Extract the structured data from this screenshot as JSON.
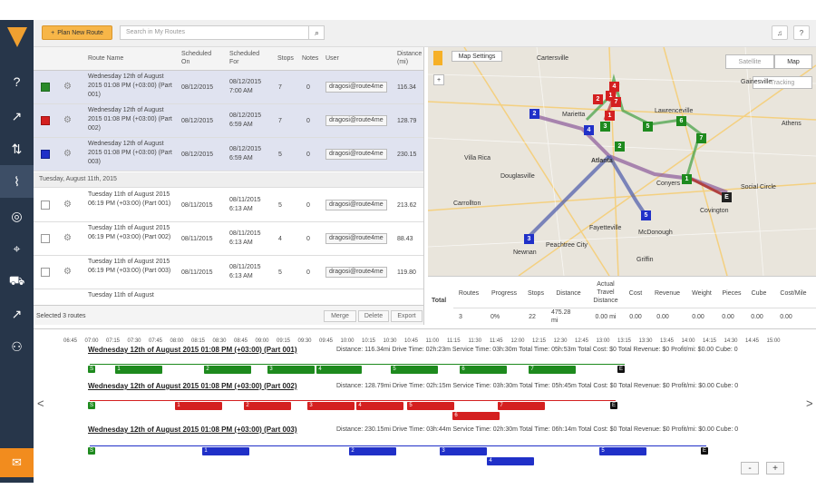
{
  "topbar": {
    "plan_button": "Plan New Route",
    "search_placeholder": "Search in My Routes"
  },
  "grid": {
    "headers": {
      "name": "Route Name",
      "scheduled_on": "Scheduled On",
      "scheduled_for": "Scheduled For",
      "stops": "Stops",
      "notes": "Notes",
      "user": "User",
      "distance": "Distance (mi)"
    },
    "rows": [
      {
        "name": "Wednesday 12th of August 2015 01:08 PM (+03:00) (Part 001)",
        "on": "08/12/2015",
        "for": "08/12/2015 7:00 AM",
        "stops": "7",
        "notes": "0",
        "user": "dragosi@route4me",
        "dist": "116.34"
      },
      {
        "name": "Wednesday 12th of August 2015 01:08 PM (+03:00) (Part 002)",
        "on": "08/12/2015",
        "for": "08/12/2015 6:59 AM",
        "stops": "7",
        "notes": "0",
        "user": "dragosi@route4me",
        "dist": "128.79"
      },
      {
        "name": "Wednesday 12th of August 2015 01:08 PM (+03:00) (Part 003)",
        "on": "08/12/2015",
        "for": "08/12/2015 6:59 AM",
        "stops": "5",
        "notes": "0",
        "user": "dragosi@route4me",
        "dist": "230.15"
      },
      {
        "name": "Tuesday 11th of August 2015 06:19 PM (+03:00) (Part 001)",
        "on": "08/11/2015",
        "for": "08/11/2015 6:13 AM",
        "stops": "5",
        "notes": "0",
        "user": "dragosi@route4me",
        "dist": "213.62"
      },
      {
        "name": "Tuesday 11th of August 2015 06:19 PM (+03:00) (Part 002)",
        "on": "08/11/2015",
        "for": "08/11/2015 6:13 AM",
        "stops": "4",
        "notes": "0",
        "user": "dragosi@route4me",
        "dist": "88.43"
      },
      {
        "name": "Tuesday 11th of August 2015 06:19 PM (+03:00) (Part 003)",
        "on": "08/11/2015",
        "for": "08/11/2015 6:13 AM",
        "stops": "5",
        "notes": "0",
        "user": "dragosi@route4me",
        "dist": "119.80"
      },
      {
        "name": "Tuesday 11th of August",
        "on": "",
        "for": "",
        "stops": "",
        "notes": "",
        "user": "",
        "dist": ""
      }
    ],
    "group_label": "Tuesday, August 11th, 2015",
    "footer": {
      "selected": "Selected 3 routes",
      "merge": "Merge",
      "delete": "Delete",
      "export": "Export"
    }
  },
  "map": {
    "settings": "Map Settings",
    "satellite": "Satellite",
    "map": "Map",
    "tracking": "Tracking",
    "city_labels": [
      "Marietta",
      "Atlanta",
      "Carrollton",
      "Newnan",
      "Peachtree City",
      "Fayetteville",
      "McDonough",
      "Social Circle",
      "Covington",
      "Lawrenceville",
      "Cartersville",
      "Gainesville",
      "Conyers",
      "Griffin",
      "Villa Rica",
      "Douglasville",
      "Athens"
    ]
  },
  "stats": {
    "headers": [
      "Routes",
      "Progress",
      "Stops",
      "Distance",
      "Actual Travel Distance",
      "Cost",
      "Revenue",
      "Weight",
      "Pieces",
      "Cube",
      "Cost/Mile"
    ],
    "total_label": "Total",
    "values": [
      "3",
      "0%",
      "22",
      "475.28 mi",
      "0.00 mi",
      "0.00",
      "0.00",
      "0.00",
      "0.00",
      "0.00",
      "0.00"
    ]
  },
  "timeline": {
    "ticks": [
      "06:45",
      "07:00",
      "07:15",
      "07:30",
      "07:45",
      "08:00",
      "08:15",
      "08:30",
      "08:45",
      "09:00",
      "09:15",
      "09:30",
      "09:45",
      "10:00",
      "10:15",
      "10:30",
      "10:45",
      "11:00",
      "11:15",
      "11:30",
      "11:45",
      "12:00",
      "12:15",
      "12:30",
      "12:45",
      "13:00",
      "13:15",
      "13:30",
      "13:45",
      "14:00",
      "14:15",
      "14:30",
      "14:45",
      "15:00"
    ],
    "routes": [
      {
        "title": "Wednesday 12th of August 2015 01:08 PM (+03:00) (Part 001)",
        "info": "Distance: 116.34mi    Drive Time: 02h:23m    Service Time: 03h:30m    Total Time: 05h:53m    Total Cost: $0    Total Revenue: $0    Profit/mi: $0.00    Cube: 0",
        "color": "#1e8a1e"
      },
      {
        "title": "Wednesday 12th of August 2015 01:08 PM (+03:00) (Part 002)",
        "info": "Distance: 128.79mi    Drive Time: 02h:15m    Service Time: 03h:30m    Total Time: 05h:45m    Total Cost: $0    Total Revenue: $0    Profit/mi: $0.00    Cube: 0",
        "color": "#d42020"
      },
      {
        "title": "Wednesday 12th of August 2015 01:08 PM (+03:00) (Part 003)",
        "info": "Distance: 230.15mi    Drive Time: 03h:44m    Service Time: 02h:30m    Total Time: 06h:14m    Total Cost: $0    Total Revenue: $0    Profit/mi: $0.00    Cube: 0",
        "color": "#2030c8"
      }
    ],
    "zoom_out": "-",
    "zoom_in": "+"
  }
}
